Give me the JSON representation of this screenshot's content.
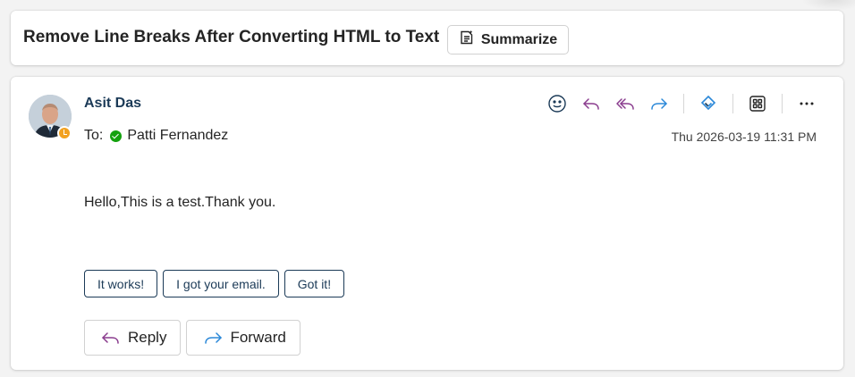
{
  "subject": {
    "title": "Remove Line Breaks After Converting HTML to Text",
    "summarize_label": "Summarize"
  },
  "message": {
    "sender_name": "Asit Das",
    "to_label": "To:",
    "recipient": "Patti Fernandez",
    "timestamp": "Thu 2026-03-19 11:31 PM",
    "body": "Hello,This is a test.Thank you.",
    "toolbar": [
      "smile-icon",
      "reply-icon",
      "reply-all-icon",
      "forward-icon",
      "loop-icon",
      "apps-icon",
      "more-icon"
    ],
    "quick_replies": [
      "It works!",
      "I got your email.",
      "Got it!"
    ],
    "reply_label": "Reply",
    "forward_label": "Forward"
  },
  "colors": {
    "accent_purple": "#8a3c8e",
    "accent_blue": "#2b88d8",
    "sender_color": "#1b3a57",
    "presence_away": "#f2a11f",
    "presence_available": "#13a10e"
  }
}
